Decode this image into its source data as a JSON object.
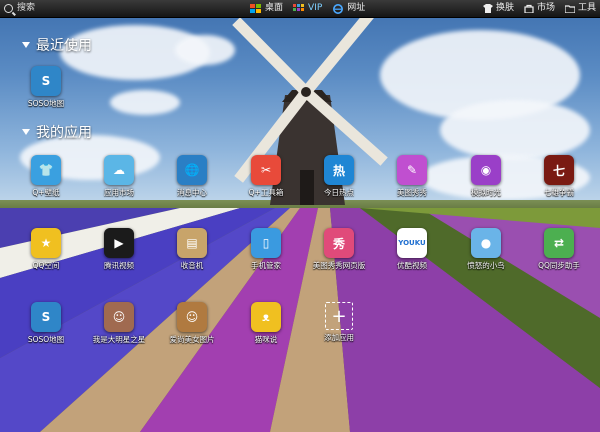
{
  "topbar": {
    "search_label": "搜索",
    "desktop_label": "桌面",
    "vip_label": "VIP",
    "web_label": "网址",
    "skin_label": "换肤",
    "market_label": "市场",
    "tools_label": "工具"
  },
  "sections": {
    "recent_title": "最近使用",
    "my_apps_title": "我的应用"
  },
  "recent_apps": [
    {
      "label": "SOSO地图",
      "icon": "soso-map-icon",
      "color": "#2f86c8",
      "glyph": "S"
    }
  ],
  "my_apps": [
    {
      "label": "Q+壁纸",
      "icon": "tshirt-icon",
      "color": "#3aa0e0",
      "glyph": "👕"
    },
    {
      "label": "应用市场",
      "icon": "app-market-icon",
      "color": "#5bb6e6",
      "glyph": "☁"
    },
    {
      "label": "消息中心",
      "icon": "message-center-icon",
      "color": "#2a7fc5",
      "glyph": "🌐"
    },
    {
      "label": "Q+工具箱",
      "icon": "toolbox-icon",
      "color": "#e84a3a",
      "glyph": "✂"
    },
    {
      "label": "今日热点",
      "icon": "hot-news-icon",
      "color": "#1f86d4",
      "glyph": "热"
    },
    {
      "label": "美图秀秀",
      "icon": "meitu-icon",
      "color": "#c04fd0",
      "glyph": "✎"
    },
    {
      "label": "模拟时光",
      "icon": "simulate-icon",
      "color": "#9a3fc8",
      "glyph": "◉"
    },
    {
      "label": "七雄争霸",
      "icon": "game-icon",
      "color": "#7a1a12",
      "glyph": "七"
    },
    {
      "label": "QQ空间",
      "icon": "qzone-icon",
      "color": "#f0c020",
      "glyph": "★"
    },
    {
      "label": "腾讯视频",
      "icon": "video-icon",
      "color": "#1b1b1b",
      "glyph": "▶"
    },
    {
      "label": "收音机",
      "icon": "radio-icon",
      "color": "#c8a46a",
      "glyph": "▤"
    },
    {
      "label": "手机管家",
      "icon": "phone-manager-icon",
      "color": "#3a9ae0",
      "glyph": "▯"
    },
    {
      "label": "美图秀秀网页版",
      "icon": "meitu-web-icon",
      "color": "#e04a7a",
      "glyph": "秀"
    },
    {
      "label": "优酷视频",
      "icon": "youku-icon",
      "color": "#ffffff",
      "glyph": "YOUKU"
    },
    {
      "label": "愤怒的小鸟",
      "icon": "angry-birds-icon",
      "color": "#6ab4e8",
      "glyph": "●"
    },
    {
      "label": "QQ同步助手",
      "icon": "qq-sync-icon",
      "color": "#4caf50",
      "glyph": "⇄"
    },
    {
      "label": "SOSO地图",
      "icon": "soso-map-icon",
      "color": "#2f86c8",
      "glyph": "S"
    },
    {
      "label": "我是大明星之星",
      "icon": "star-photo-icon",
      "color": "#a06a50",
      "glyph": "☺"
    },
    {
      "label": "爱尚美女图片",
      "icon": "photo-icon",
      "color": "#b07a40",
      "glyph": "☺"
    },
    {
      "label": "猫咪说",
      "icon": "cat-icon",
      "color": "#f0c020",
      "glyph": "ᴥ"
    },
    {
      "label": "添加应用",
      "icon": "add-app-icon",
      "color": "transparent",
      "glyph": "+"
    }
  ]
}
